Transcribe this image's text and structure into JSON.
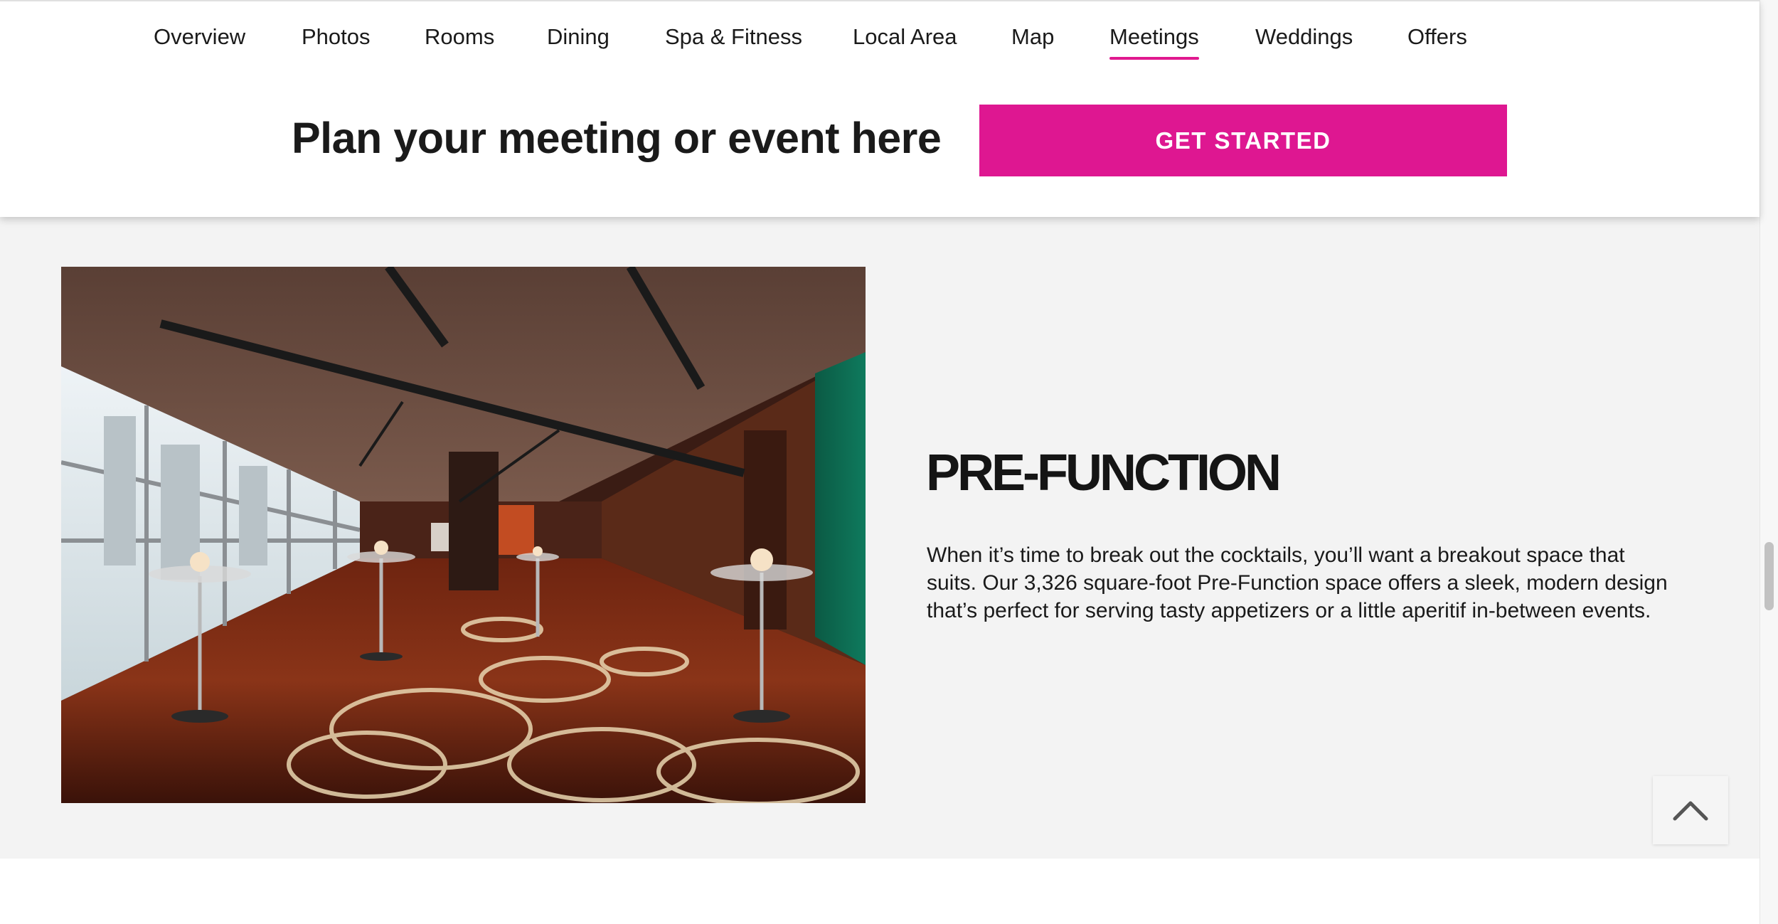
{
  "nav": {
    "items": [
      {
        "label": "Overview"
      },
      {
        "label": "Photos"
      },
      {
        "label": "Rooms"
      },
      {
        "label": "Dining"
      },
      {
        "label": "Spa & Fitness"
      },
      {
        "label": "Local Area"
      },
      {
        "label": "Map"
      },
      {
        "label": "Meetings"
      },
      {
        "label": "Weddings"
      },
      {
        "label": "Offers"
      }
    ],
    "active": "Meetings"
  },
  "cta": {
    "heading": "Plan your meeting or event here",
    "button_label": "GET STARTED"
  },
  "section": {
    "title": "PRE-FUNCTION",
    "description": "When it’s time to break out the cocktails, you’ll want a breakout space that suits. Our 3,326 square-foot Pre-Function space offers a sleek, modern design that’s perfect for serving tasty appetizers or a little aperitif in-between events.",
    "photo_alt": "Pre-Function space"
  },
  "back_to_top": {
    "icon": "chevron-up-icon"
  },
  "colors": {
    "accent": "#de1791",
    "section_bg": "#f3f3f3",
    "text": "#1a1a1a"
  }
}
